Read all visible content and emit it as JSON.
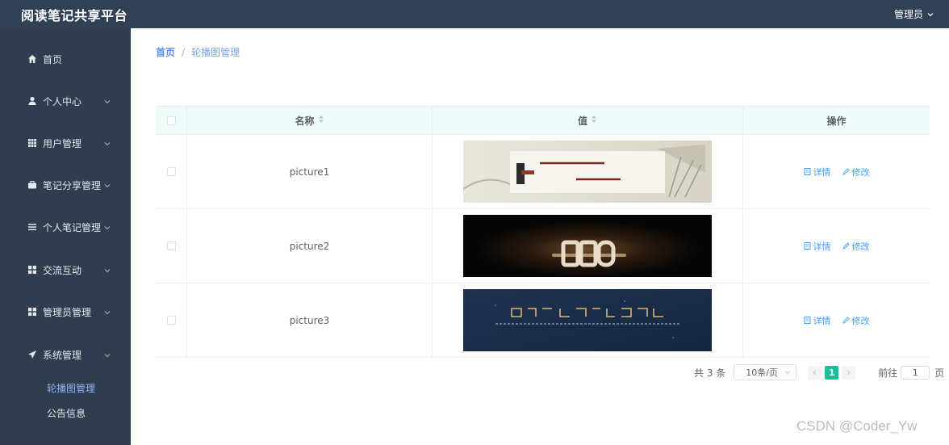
{
  "header": {
    "app_title": "阅读笔记共享平台",
    "user_label": "管理员"
  },
  "sidebar": {
    "items": [
      {
        "label": "首页",
        "icon": "home-icon"
      },
      {
        "label": "个人中心",
        "icon": "user-icon"
      },
      {
        "label": "用户管理",
        "icon": "grid-icon"
      },
      {
        "label": "笔记分享管理",
        "icon": "briefcase-icon"
      },
      {
        "label": "个人笔记管理",
        "icon": "list-icon"
      },
      {
        "label": "交流互动",
        "icon": "apps-icon"
      },
      {
        "label": "管理员管理",
        "icon": "apps-icon"
      },
      {
        "label": "系统管理",
        "icon": "send-icon"
      }
    ],
    "sub_items": [
      {
        "label": "轮播图管理",
        "active": true
      },
      {
        "label": "公告信息",
        "active": false
      }
    ]
  },
  "breadcrumb": {
    "home": "首页",
    "separator": "/",
    "current": "轮播图管理"
  },
  "table": {
    "columns": [
      "名称",
      "值",
      "操作"
    ],
    "rows": [
      {
        "name": "picture1",
        "detail": "详情",
        "edit": "修改"
      },
      {
        "name": "picture2",
        "detail": "详情",
        "edit": "修改"
      },
      {
        "name": "picture3",
        "detail": "详情",
        "edit": "修改"
      }
    ]
  },
  "pagination": {
    "total": "共 3 条",
    "page_size": "10条/页",
    "current_page": "1",
    "goto_label": "前往",
    "goto_value": "1",
    "goto_suffix": "页"
  },
  "watermark": "CSDN @Coder_Yw",
  "colors": {
    "header_bg": "#304156",
    "sidebar_bg": "#2f3d4e",
    "accent": "#19be9b",
    "link": "#409eff",
    "table_header_bg": "#eefcf9"
  }
}
